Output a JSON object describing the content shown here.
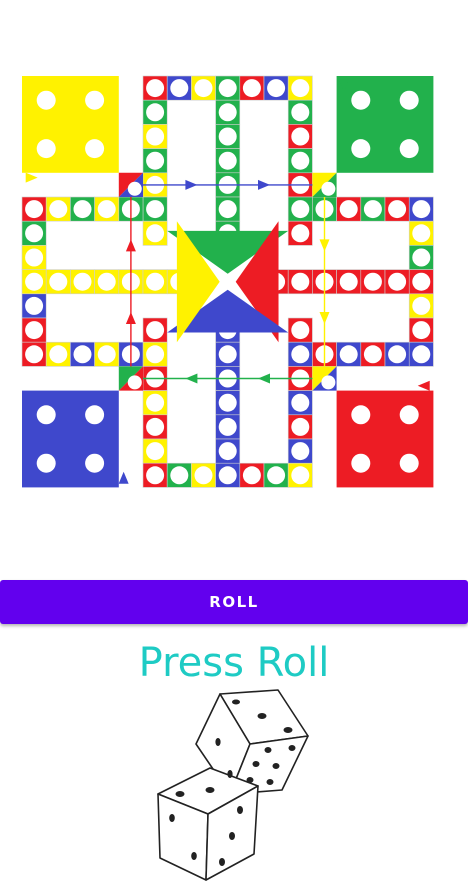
{
  "colors": {
    "yellow": "#FFF200",
    "green": "#22B14C",
    "red": "#ED1C24",
    "blue": "#3F48CC",
    "accent": "#6200EE",
    "status_text": "#1ECBC4"
  },
  "board": {
    "player_bases": [
      "yellow",
      "green",
      "blue",
      "red"
    ],
    "center_arrow_colors": [
      "green",
      "red",
      "blue",
      "yellow"
    ]
  },
  "controls": {
    "roll_label": "ROLL"
  },
  "status": {
    "message": "Press Roll"
  },
  "dice": {
    "icon": "two-dice-icon"
  }
}
